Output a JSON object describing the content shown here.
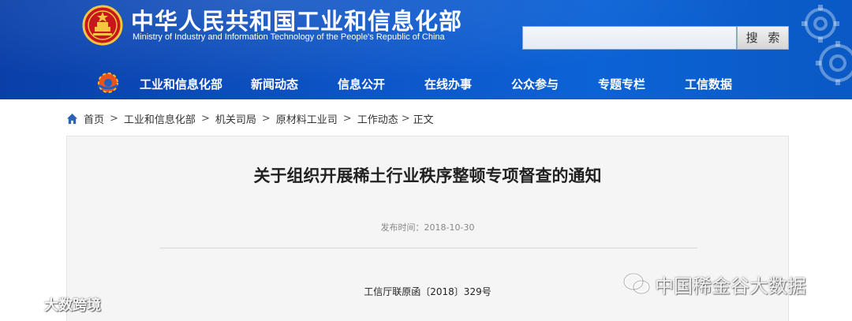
{
  "header": {
    "site_title": "中华人民共和国工业和信息化部",
    "site_subtitle": "Ministry of Industry and Information Technology of the People's Republic of China",
    "search": {
      "placeholder": "",
      "button_label": "搜 索"
    },
    "colors": {
      "banner": "#0d56c9",
      "nav_text": "#ffffff"
    }
  },
  "nav": {
    "items": [
      {
        "label": "工业和信息化部"
      },
      {
        "label": "新闻动态"
      },
      {
        "label": "信息公开"
      },
      {
        "label": "在线办事"
      },
      {
        "label": "公众参与"
      },
      {
        "label": "专题专栏"
      },
      {
        "label": "工信数据"
      }
    ]
  },
  "breadcrumb": {
    "home_icon": "home-icon",
    "separator": ">",
    "items": [
      {
        "label": "首页"
      },
      {
        "label": "工业和信息化部"
      },
      {
        "label": "机关司局"
      },
      {
        "label": "原材料工业司"
      },
      {
        "label": "工作动态"
      },
      {
        "label": "正文"
      }
    ]
  },
  "article": {
    "title": "关于组织开展稀土行业秩序整顿专项督查的通知",
    "publish_time": "发布时间：2018-10-30",
    "doc_number": "工信厅联原函〔2018〕329号"
  },
  "watermarks": {
    "right": "中国稀金谷大数据",
    "left": "大数跨境"
  }
}
